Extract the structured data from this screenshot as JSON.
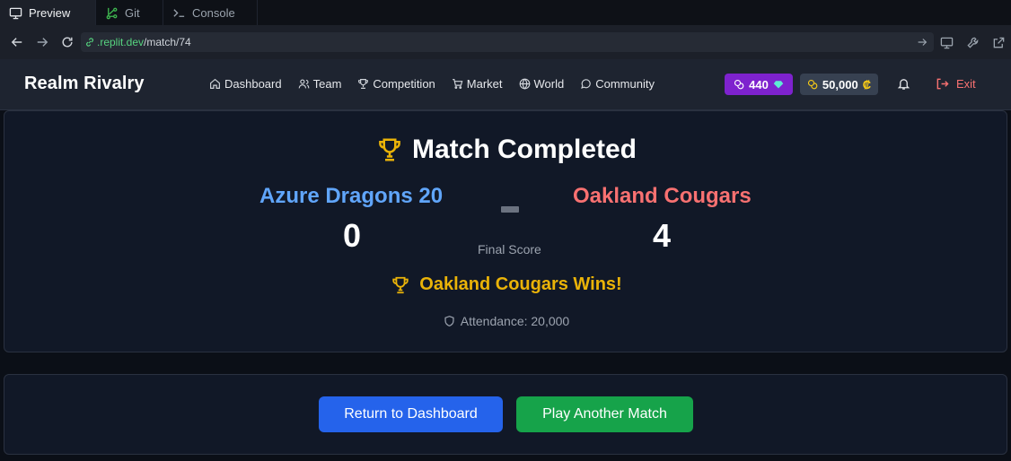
{
  "ide": {
    "tabs": [
      {
        "label": "Preview"
      },
      {
        "label": "Git"
      },
      {
        "label": "Console"
      }
    ]
  },
  "browser": {
    "url_domain": ".replit.dev",
    "url_path": "/match/74"
  },
  "header": {
    "brand": "Realm Rivalry",
    "nav": [
      {
        "label": "Dashboard",
        "icon": "home-icon"
      },
      {
        "label": "Team",
        "icon": "users-icon"
      },
      {
        "label": "Competition",
        "icon": "trophy-icon"
      },
      {
        "label": "Market",
        "icon": "cart-icon"
      },
      {
        "label": "World",
        "icon": "globe-icon"
      },
      {
        "label": "Community",
        "icon": "chat-icon"
      }
    ],
    "gems": "440",
    "coins": "50,000",
    "coin_symbol": "₡",
    "exit_label": "Exit"
  },
  "match": {
    "title": "Match Completed",
    "home_team": "Azure Dragons 20",
    "away_team": "Oakland Cougars",
    "home_score": "0",
    "away_score": "4",
    "final_score_label": "Final Score",
    "winner_text": "Oakland Cougars Wins!",
    "attendance": "Attendance: 20,000"
  },
  "actions": {
    "return_label": "Return to Dashboard",
    "play_again_label": "Play Another Match"
  },
  "colors": {
    "home": "#60a5fa",
    "away": "#f87171",
    "winner": "#eab308",
    "gems_bg": "#7e22ce",
    "primary_button": "#2563eb",
    "success_button": "#16a34a"
  }
}
